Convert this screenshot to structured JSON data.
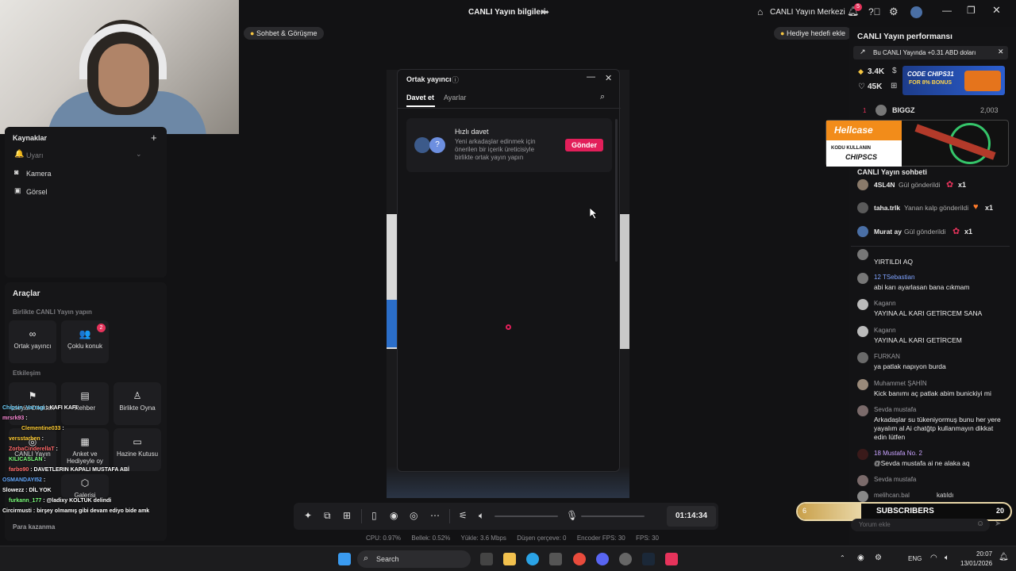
{
  "header": {
    "title": "CANLI Yayın bilgileri",
    "chat_meet_label": "Sohbet & Görüşme",
    "center_label": "CANLI Yayın Merkezi",
    "notif_count": "5",
    "gift_goal_label": "Hediye hedefi ekle"
  },
  "sources": {
    "title": "Kaynaklar",
    "items": [
      {
        "label": "Uyarı"
      },
      {
        "label": "Kamera"
      },
      {
        "label": "Görsel"
      }
    ]
  },
  "tools": {
    "title": "Araçlar",
    "section_live": "Birlikte CANLI Yayın yapın",
    "cohost_label": "Ortak yayıncı",
    "multi_guest_label": "Çoklu konuk",
    "multi_guest_badge": "2",
    "section_interaction": "Etkileşim",
    "interaction_items": [
      "İzleyici Dilekleri",
      "Rehber",
      "Birlikte Oyna",
      "CANLI Yayın",
      "Anket ve Hediyeyle oy",
      "Hazine Kutusu",
      "Galerisi"
    ],
    "earn_label": "Para kazanma"
  },
  "overlay_chat": [
    {
      "user": "Chipsin_Varragi",
      "text": ": KAFI KAFI",
      "color": "#6fd3ff"
    },
    {
      "user": "mrsrk93",
      "text": ":",
      "color": "#ff8ad8"
    },
    {
      "user": "Clementine033",
      "text": ":",
      "color": "#ffcc33"
    },
    {
      "user": "versstarben",
      "text": ":",
      "color": "#ffcc33"
    },
    {
      "user": "ZorbaCinderellaT",
      "text": ":",
      "color": "#ff6868"
    },
    {
      "user": "KILICASLAN",
      "text": ":",
      "color": "#7cff7c"
    },
    {
      "user": "farbo90",
      "text": ": DAVETLERIN KAPALI MUSTAFA ABİ",
      "color": "#ff6a6a"
    },
    {
      "user": "OSMANDAYI52",
      "text": ":",
      "color": "#66aaff"
    },
    {
      "user": "Slowezz",
      "text": ": DİL YOK",
      "color": "#ffffff"
    },
    {
      "user": "furkann_177",
      "text": ": @ladixy KOLTUK delindi",
      "color": "#7cff7c"
    },
    {
      "user": "Circirmusti",
      "text": ": birşey olmamış gibi devam ediyo bide amk",
      "color": "#ffffff"
    }
  ],
  "modal": {
    "title": "Ortak yayıncı",
    "tab_invite": "Davet et",
    "tab_settings": "Ayarlar",
    "quick_invite_title": "Hızlı davet",
    "quick_invite_desc": "Yeni arkadaşlar edinmek için önerilen bir içerik üreticisiyle birlikte ortak yayın yapın",
    "send_label": "Gönder"
  },
  "controls": {
    "timer": "01:14:34"
  },
  "stats": {
    "cpu": "CPU: 0.97%",
    "memory": "Bellek: 0.52%",
    "upload": "Yükle: 3.6 Mbps",
    "dropped": "Düşen çerçeve: 0",
    "encoder_fps": "Encoder FPS: 30",
    "fps": "FPS: 30"
  },
  "right": {
    "perf_title": "CANLI Yayın performansı",
    "perf_banner": "Bu CANLI Yayında +0.31 ABD doları",
    "diamonds": "3.4K",
    "likes": "45K",
    "top_rank": "1",
    "top_user": "BIGGZ",
    "top_score": "2,003",
    "ad_code": "CODE CHIPS31",
    "ad_bonus": "FOR 8% BONUS",
    "hell_brand": "Hellcase",
    "hell_line1": "KODU KULLANIN",
    "hell_line2": "CHIPSCS",
    "chat_title": "CANLI Yayın sohbeti",
    "gifts": [
      {
        "user": "4SL4N",
        "action": "Gül gönderildi",
        "count": "x1"
      },
      {
        "user": "taha.trlk",
        "action": "Yanan kalp gönderildi",
        "count": "x1"
      },
      {
        "user": "Murat ay",
        "action": "Gül gönderildi",
        "count": "x1"
      }
    ],
    "messages": [
      {
        "user": "",
        "text": "YIRTILDI AQ"
      },
      {
        "user": "12  TSebastian",
        "text": "abi karı ayarlasan bana cıkmam"
      },
      {
        "user": "Kagann",
        "text": "YAYINA AL KARI GETİRCEM SANA"
      },
      {
        "user": "Kagann",
        "text": "YAYINA AL KARI GETİRCEM"
      },
      {
        "user": "FURKAN",
        "text": "ya patlak napıyon burda"
      },
      {
        "user": "Muhammet ŞAHİN",
        "text": "Kick banımı aç patlak abim bunickiyi mi"
      },
      {
        "user": "Sevda mustafa",
        "text": "Arkadaşlar su tükeniyormuş bunu her yere yayalım al Ai chatğtp kullanmayın dikkat edin lütfen"
      },
      {
        "user": "18  Mustafa  No. 2",
        "text": "@Sevda mustafa ai ne alaka aq"
      },
      {
        "user": "Sevda mustafa",
        "text": "katıldı"
      },
      {
        "user": "melihcan.bal",
        "text": "katıldı"
      }
    ],
    "comment_placeholder": "Yorum ekle",
    "subs_left": "6",
    "subs_label": "SUBSCRIBERS",
    "subs_right": "20"
  },
  "taskbar": {
    "search_label": "Search",
    "lang": "ENG",
    "time": "20:07",
    "date": "13/01/2026"
  }
}
